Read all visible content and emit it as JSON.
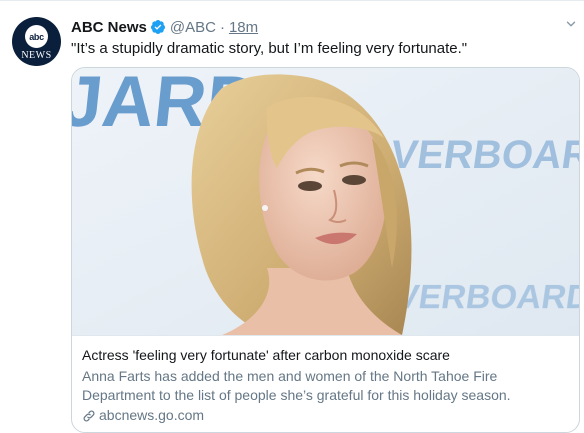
{
  "tweet": {
    "avatar": {
      "logo_small": "abc",
      "logo_word": "NEWS"
    },
    "author_name": "ABC News",
    "handle": "@ABC",
    "separator": "·",
    "time": "18m",
    "text": "\"It’s a stupidly dramatic story, but I’m feeling very fortunate.\"",
    "verified_icon": "verified-badge-icon",
    "verified_color": "#1da1f2"
  },
  "card": {
    "image_description_icon": "photo",
    "image_backdrop_words": [
      "JARD",
      "OVERBOARD",
      "OVERBOARD"
    ],
    "title": "Actress 'feeling very fortunate' after carbon monoxide scare",
    "description": "Anna Farts has added the men and women of the North Tahoe Fire Department to the list of people she’s grateful for this holiday season.",
    "domain": "abcnews.go.com",
    "domain_icon": "link-icon"
  },
  "colors": {
    "text_primary": "#14171a",
    "text_secondary": "#657786",
    "border": "#ccd6dd",
    "backdrop_blue": "#5b93c9"
  }
}
